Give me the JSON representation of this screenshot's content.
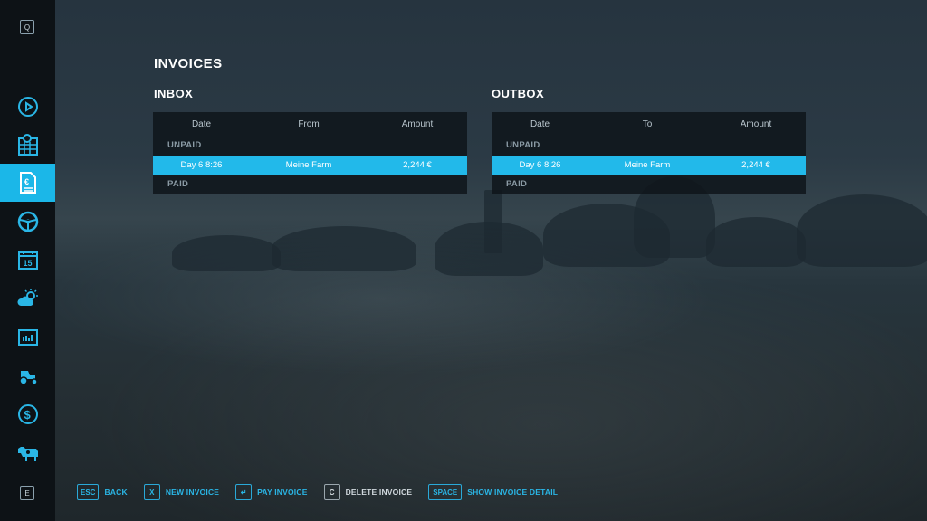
{
  "sidebar": {
    "top_key": "Q",
    "bottom_key": "E",
    "items": [
      {
        "icon": "map-pin-icon"
      },
      {
        "icon": "calendar-grid-icon"
      },
      {
        "icon": "euro-document-icon",
        "active": true
      },
      {
        "icon": "steering-wheel-icon"
      },
      {
        "icon": "calendar-15-icon",
        "day": "15"
      },
      {
        "icon": "weather-icon"
      },
      {
        "icon": "statistics-icon"
      },
      {
        "icon": "tractor-icon"
      },
      {
        "icon": "dollar-icon",
        "symbol": "$"
      },
      {
        "icon": "cow-icon"
      }
    ],
    "accent": "#1bb7e8"
  },
  "page": {
    "title": "INVOICES"
  },
  "inbox": {
    "title": "INBOX",
    "columns": [
      "Date",
      "From",
      "Amount"
    ],
    "unpaid_label": "UNPAID",
    "paid_label": "PAID",
    "unpaid_rows": [
      {
        "date": "Day 6 8:26",
        "party": "Meine Farm",
        "amount": "2,244 €"
      }
    ]
  },
  "outbox": {
    "title": "OUTBOX",
    "columns": [
      "Date",
      "To",
      "Amount"
    ],
    "unpaid_label": "UNPAID",
    "paid_label": "PAID",
    "unpaid_rows": [
      {
        "date": "Day 6 8:26",
        "party": "Meine Farm",
        "amount": "2,244 €"
      }
    ]
  },
  "footer": {
    "hints": [
      {
        "key": "ESC",
        "label": "BACK",
        "enabled": true
      },
      {
        "key": "X",
        "label": "NEW INVOICE",
        "enabled": true
      },
      {
        "key": "↵",
        "label": "PAY INVOICE",
        "enabled": true
      },
      {
        "key": "C",
        "label": "DELETE INVOICE",
        "enabled": false
      },
      {
        "key": "SPACE",
        "label": "SHOW INVOICE DETAIL",
        "enabled": true
      }
    ]
  }
}
